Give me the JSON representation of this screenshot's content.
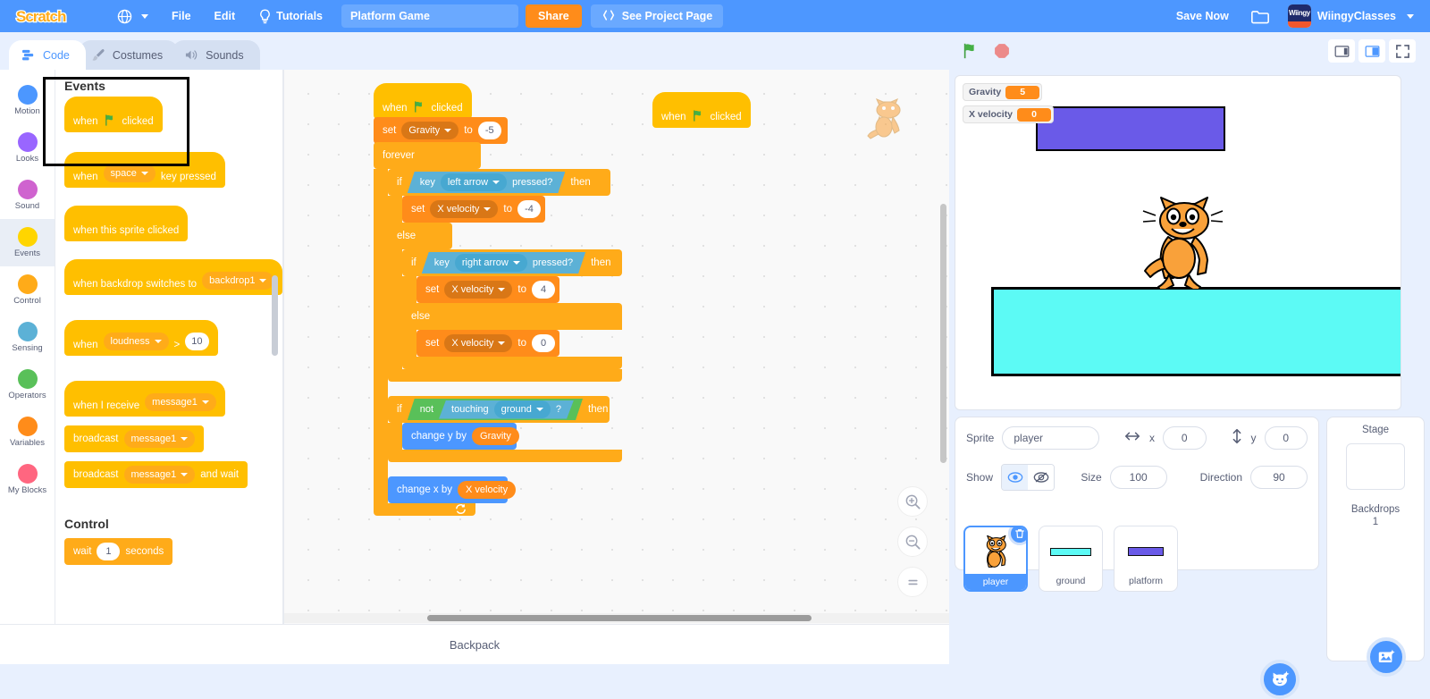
{
  "menu": {
    "logo_text": "SCRATCH",
    "language_icon": "globe-icon",
    "file": "File",
    "edit": "Edit",
    "tutorials": "Tutorials",
    "tutorials_icon": "lightbulb-icon",
    "project_title": "Platform Game",
    "project_title_placeholder": "Project title",
    "share": "Share",
    "see_project_page": "See Project Page",
    "see_project_page_icon": "project-page-icon",
    "save_now": "Save Now",
    "folder_icon": "folder-icon",
    "avatar_text": "Wiingy",
    "username": "WiingyClasses"
  },
  "tabs": [
    {
      "label": "Code",
      "icon": "code-icon",
      "active": true
    },
    {
      "label": "Costumes",
      "icon": "paintbrush-icon",
      "active": false
    },
    {
      "label": "Sounds",
      "icon": "speaker-icon",
      "active": false
    }
  ],
  "stage_controls": {
    "green_flag": "green-flag-icon",
    "stop": "stop-icon",
    "small_stage": "small-stage-icon",
    "large_stage": "large-stage-icon",
    "fullscreen": "fullscreen-icon"
  },
  "categories": [
    {
      "label": "Motion",
      "color": "#4c97ff"
    },
    {
      "label": "Looks",
      "color": "#9966ff"
    },
    {
      "label": "Sound",
      "color": "#cf63cf"
    },
    {
      "label": "Events",
      "color": "#ffd500",
      "selected": true
    },
    {
      "label": "Control",
      "color": "#ffab19"
    },
    {
      "label": "Sensing",
      "color": "#5cb1d6"
    },
    {
      "label": "Operators",
      "color": "#59c059"
    },
    {
      "label": "Variables",
      "color": "#ff8c1a"
    },
    {
      "label": "My Blocks",
      "color": "#ff6680"
    }
  ],
  "palette": {
    "events_header": "Events",
    "control_header": "Control",
    "blocks": {
      "when_flag_clicked_a": "when",
      "when_flag_clicked_b": "clicked",
      "when_key_a": "when",
      "when_key_value": "space",
      "when_key_b": "key pressed",
      "when_sprite_clicked": "when this sprite clicked",
      "when_backdrop_a": "when backdrop switches to",
      "when_backdrop_value": "backdrop1",
      "when_loudness_a": "when",
      "when_loudness_value": "loudness",
      "when_loudness_op": ">",
      "when_loudness_num": "10",
      "when_receive_a": "when I receive",
      "when_receive_value": "message1",
      "broadcast_a": "broadcast",
      "broadcast_value": "message1",
      "broadcast_wait_a": "broadcast",
      "broadcast_wait_value": "message1",
      "broadcast_wait_b": "and wait",
      "wait_a": "wait",
      "wait_num": "1",
      "wait_b": "seconds"
    }
  },
  "script": {
    "hat_when": "when",
    "hat_clicked": "clicked",
    "set_label": "set",
    "set_gravity_var": "Gravity",
    "to_label": "to",
    "gravity_value": "-5",
    "forever": "forever",
    "if_label": "if",
    "then_label": "then",
    "else_label": "else",
    "key_label": "key",
    "left_arrow": "left arrow",
    "right_arrow": "right arrow",
    "pressed_label": "pressed?",
    "xvel_var": "X velocity",
    "xvel_left": "-4",
    "xvel_right": "4",
    "xvel_zero": "0",
    "not_label": "not",
    "touching_label": "touching",
    "ground_value": "ground",
    "question": "?",
    "change_y_by": "change y by",
    "gravity_reporter": "Gravity",
    "change_x_by": "change x by",
    "xvel_reporter": "X velocity"
  },
  "script_detached": {
    "hat_when": "when",
    "hat_clicked": "clicked"
  },
  "canvas": {
    "zoom_in": "zoom-in-icon",
    "zoom_out": "zoom-out-icon",
    "zoom_reset": "zoom-reset-icon"
  },
  "backpack": {
    "label": "Backpack"
  },
  "stage": {
    "monitors": [
      {
        "name": "Gravity",
        "value": "5"
      },
      {
        "name": "X velocity",
        "value": "0"
      }
    ],
    "sprites_on_stage": [
      {
        "name": "platform",
        "color": "#6a5ae8"
      },
      {
        "name": "ground",
        "color": "#5cfaf5"
      },
      {
        "name": "player",
        "color": "#ffab19"
      }
    ]
  },
  "sprite_info": {
    "sprite_label": "Sprite",
    "sprite_name": "player",
    "x_label": "x",
    "x_value": "0",
    "y_label": "y",
    "y_value": "0",
    "show_label": "Show",
    "size_label": "Size",
    "size_value": "100",
    "direction_label": "Direction",
    "direction_value": "90"
  },
  "sprite_list": [
    {
      "name": "player",
      "selected": true
    },
    {
      "name": "ground",
      "selected": false
    },
    {
      "name": "platform",
      "selected": false
    }
  ],
  "stage_panel": {
    "title": "Stage",
    "backdrops_label": "Backdrops",
    "backdrops_count": "1",
    "add_sprite_icon": "choose-sprite-icon",
    "add_backdrop_icon": "choose-backdrop-icon"
  },
  "colors": {
    "brand_blue": "#4c97ff",
    "orange": "#ff8c1a",
    "events_yellow": "#ffbf00",
    "control_orange": "#ffab19",
    "motion_blue": "#4c97ff",
    "sensing_blue": "#5cb1d6",
    "operators_green": "#59c059"
  }
}
